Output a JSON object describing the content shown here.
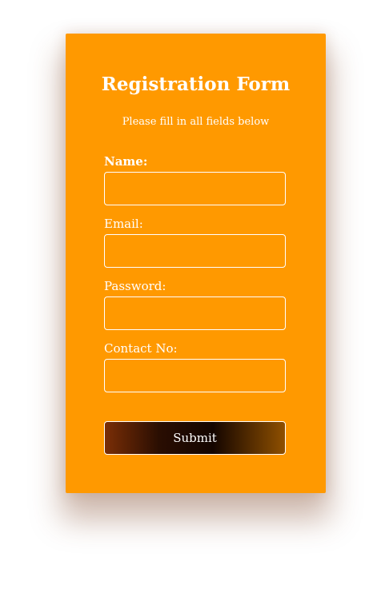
{
  "form": {
    "title": "Registration Form",
    "subtitle": "Please fill in all fields below",
    "fields": [
      {
        "label": "Name:",
        "value": "",
        "placeholder": ""
      },
      {
        "label": "Email:",
        "value": "",
        "placeholder": ""
      },
      {
        "label": "Password:",
        "value": "",
        "placeholder": ""
      },
      {
        "label": "Contact No:",
        "value": "",
        "placeholder": ""
      }
    ],
    "submit_label": "Submit"
  },
  "colors": {
    "card_background": "#ff9900",
    "text": "#ffffff",
    "field_border": "#ffffff",
    "button_gradient_start": "#7a2e06",
    "button_gradient_end": "#8f5000"
  }
}
